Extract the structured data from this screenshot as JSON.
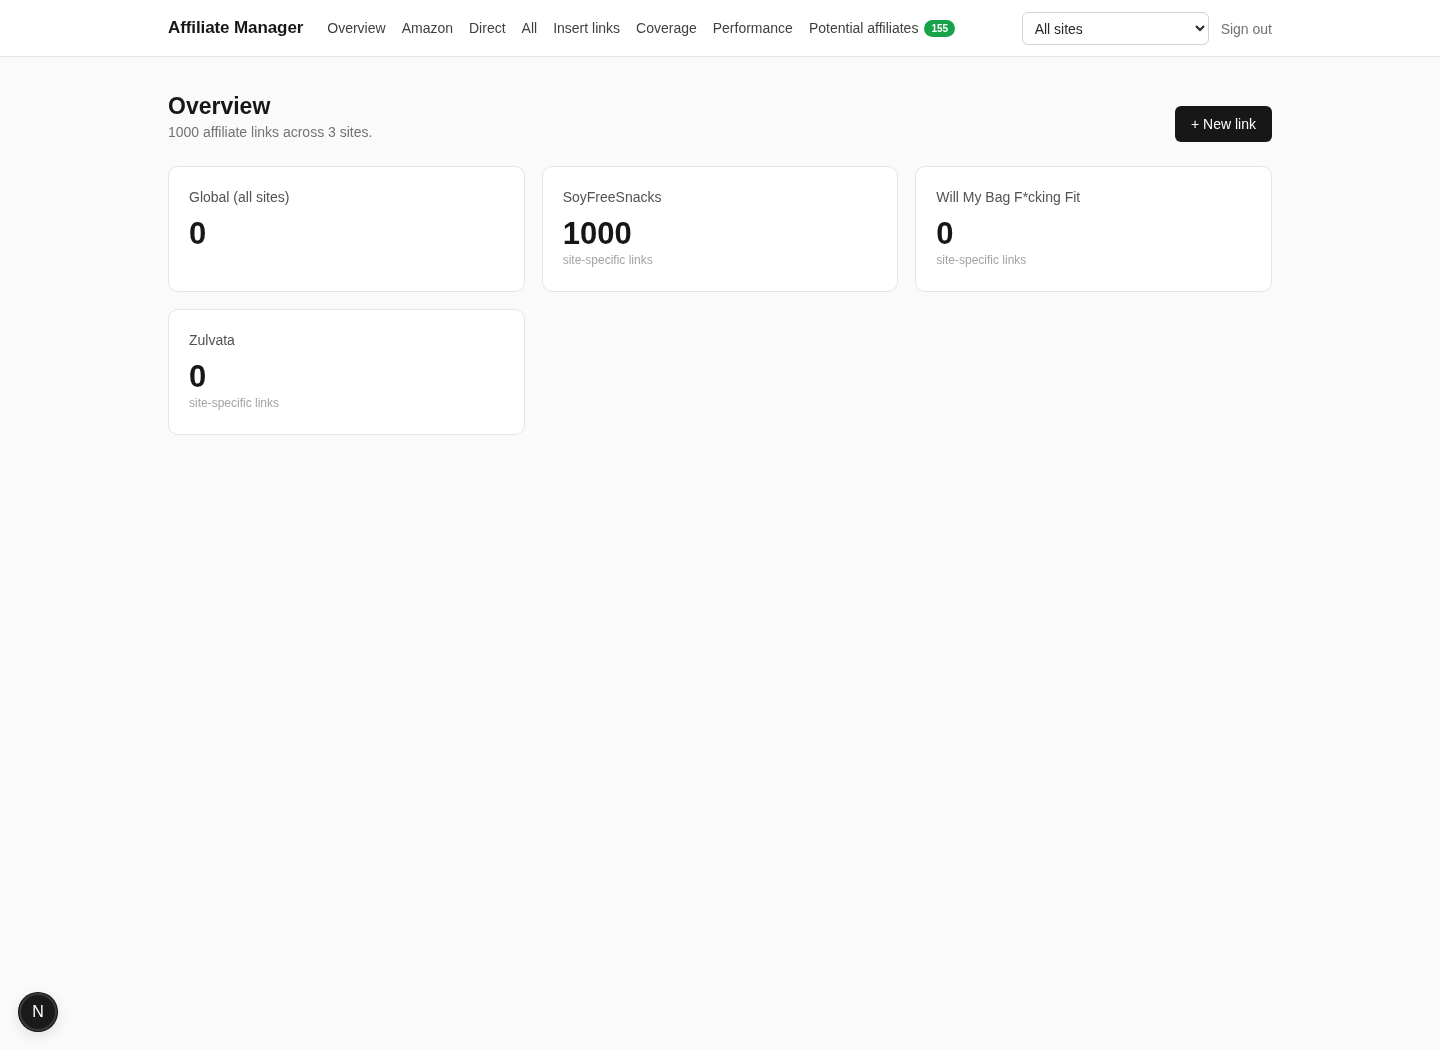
{
  "header": {
    "brand": "Affiliate Manager",
    "nav": [
      {
        "label": "Overview"
      },
      {
        "label": "Amazon"
      },
      {
        "label": "Direct"
      },
      {
        "label": "All"
      },
      {
        "label": "Insert links"
      },
      {
        "label": "Coverage"
      },
      {
        "label": "Performance"
      },
      {
        "label": "Potential affiliates",
        "badge": "155"
      }
    ],
    "site_select": {
      "value": "All sites"
    },
    "sign_out": "Sign out"
  },
  "page": {
    "title": "Overview",
    "subtitle": "1000 affiliate links across 3 sites.",
    "new_button": "+ New link"
  },
  "cards": [
    {
      "name": "Global (all sites)",
      "count": "0"
    },
    {
      "name": "SoyFreeSnacks",
      "count": "1000",
      "caption": "site-specific links"
    },
    {
      "name": "Will My Bag F*cking Fit",
      "count": "0",
      "caption": "site-specific links"
    },
    {
      "name": "Zulvata",
      "count": "0",
      "caption": "site-specific links"
    }
  ],
  "dev_indicator": {
    "label": "N"
  }
}
